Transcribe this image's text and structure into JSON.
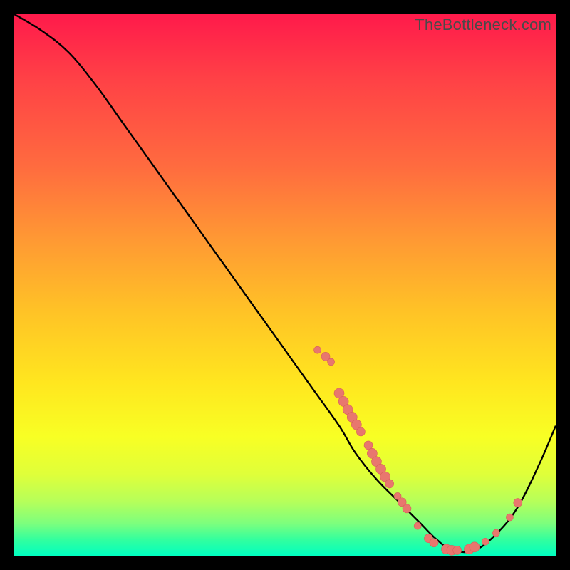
{
  "watermark": "TheBottleneck.com",
  "colors": {
    "curve_stroke": "#000000",
    "dot_fill": "#e8776e",
    "dot_stroke": "#d65f58"
  },
  "chart_data": {
    "type": "line",
    "title": "",
    "xlabel": "",
    "ylabel": "",
    "xlim": [
      0,
      100
    ],
    "ylim": [
      0,
      100
    ],
    "grid": false,
    "series": [
      {
        "name": "curve",
        "x": [
          0,
          5,
          10,
          15,
          20,
          25,
          30,
          35,
          40,
          45,
          50,
          55,
          60,
          63,
          67,
          71,
          75,
          78,
          81,
          85,
          89,
          93,
          97,
          100
        ],
        "y": [
          100,
          97,
          93,
          87,
          80,
          73,
          66,
          59,
          52,
          45,
          38,
          31,
          24,
          19,
          14,
          10,
          6,
          3,
          1,
          1,
          4,
          9,
          17,
          24
        ]
      }
    ],
    "dots": [
      {
        "x": 56.0,
        "y": 38.0,
        "r": 5
      },
      {
        "x": 57.5,
        "y": 36.8,
        "r": 6
      },
      {
        "x": 58.5,
        "y": 35.8,
        "r": 5
      },
      {
        "x": 60.0,
        "y": 30.0,
        "r": 7
      },
      {
        "x": 60.8,
        "y": 28.5,
        "r": 7
      },
      {
        "x": 61.6,
        "y": 27.0,
        "r": 7
      },
      {
        "x": 62.4,
        "y": 25.6,
        "r": 7
      },
      {
        "x": 63.2,
        "y": 24.2,
        "r": 7
      },
      {
        "x": 64.0,
        "y": 22.9,
        "r": 6
      },
      {
        "x": 65.4,
        "y": 20.4,
        "r": 6
      },
      {
        "x": 66.1,
        "y": 18.9,
        "r": 7
      },
      {
        "x": 66.9,
        "y": 17.4,
        "r": 7
      },
      {
        "x": 67.7,
        "y": 16.0,
        "r": 7
      },
      {
        "x": 68.5,
        "y": 14.6,
        "r": 7
      },
      {
        "x": 69.3,
        "y": 13.3,
        "r": 6
      },
      {
        "x": 70.8,
        "y": 11.0,
        "r": 5
      },
      {
        "x": 71.6,
        "y": 9.9,
        "r": 6
      },
      {
        "x": 72.5,
        "y": 8.7,
        "r": 6
      },
      {
        "x": 74.5,
        "y": 5.5,
        "r": 5
      },
      {
        "x": 76.5,
        "y": 3.2,
        "r": 6
      },
      {
        "x": 77.5,
        "y": 2.4,
        "r": 6
      },
      {
        "x": 79.8,
        "y": 1.2,
        "r": 7
      },
      {
        "x": 80.8,
        "y": 1.0,
        "r": 7
      },
      {
        "x": 81.8,
        "y": 1.0,
        "r": 6
      },
      {
        "x": 84.0,
        "y": 1.2,
        "r": 7
      },
      {
        "x": 85.0,
        "y": 1.6,
        "r": 7
      },
      {
        "x": 87.0,
        "y": 2.6,
        "r": 5
      },
      {
        "x": 89.0,
        "y": 4.2,
        "r": 5
      },
      {
        "x": 91.5,
        "y": 7.1,
        "r": 5
      },
      {
        "x": 93.0,
        "y": 9.8,
        "r": 6
      }
    ]
  }
}
